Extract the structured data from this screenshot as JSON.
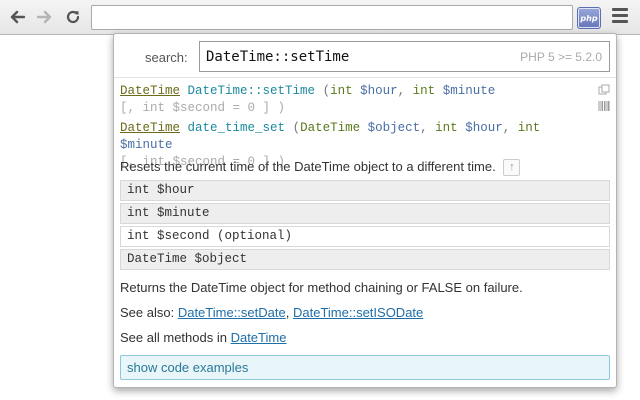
{
  "browser": {
    "back_icon": "arrow-left-icon",
    "forward_icon": "arrow-right-icon",
    "reload_icon": "reload-icon",
    "omnibox_value": "",
    "extension_label": "php",
    "menu_icon": "hamburger-menu-icon"
  },
  "popup": {
    "search_label": "search:",
    "search_value": "DateTime::setTime",
    "version": "PHP 5 >= 5.2.0",
    "signatures": [
      {
        "class_link": "DateTime",
        "function": "DateTime::setTime",
        "open": "(",
        "p1_type": "int",
        "p1_name": "$hour",
        "comma1": ",",
        "p2_type": "int",
        "p2_name": "$minute",
        "optional": "[, int $second = 0 ] )"
      },
      {
        "class_link": "DateTime",
        "function": "date_time_set",
        "open": "(",
        "p0_type": "DateTime",
        "p0_name": "$object",
        "comma0": ",",
        "p1_type": "int",
        "p1_name": "$hour",
        "comma1": ",",
        "p2_type": "int",
        "p2_name": "$minute",
        "optional": "[, int $second = 0 ] )"
      }
    ],
    "description": "Resets the current time of the DateTime object to a different time.",
    "up_glyph": "↑",
    "params": [
      "int $hour",
      "int $minute",
      "int $second (optional)",
      "DateTime $object"
    ],
    "returns": "Returns the DateTime object for method chaining or FALSE on failure.",
    "see_also_label": "See also:",
    "see_also_links": [
      "DateTime::setDate",
      "DateTime::setISODate"
    ],
    "see_also_sep": ",",
    "all_methods_label": "See all methods in",
    "all_methods_link": "DateTime",
    "code_examples_button": "show code examples"
  }
}
